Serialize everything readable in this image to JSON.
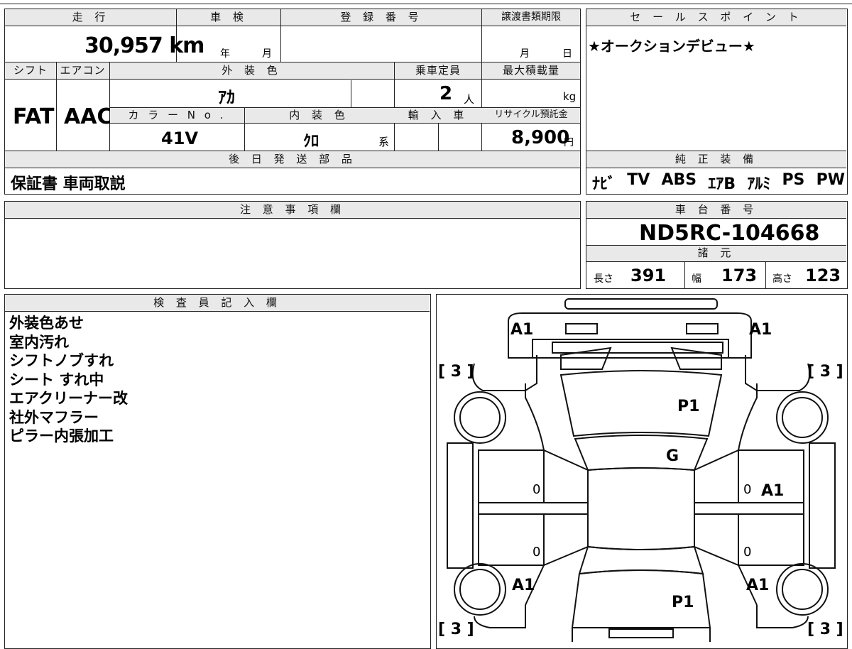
{
  "top_form": {
    "mileage": {
      "header": "走 行",
      "value": "30,957 km"
    },
    "shaken": {
      "header": "車 検",
      "year_unit": "年",
      "month_unit": "月"
    },
    "registration": {
      "header": "登 録 番 号",
      "value": ""
    },
    "transfer_deadline": {
      "header": "譲渡書類期限",
      "month_unit": "月",
      "day_unit": "日"
    },
    "shift": {
      "header": "シフト",
      "value": "FAT"
    },
    "aircon": {
      "header": "エアコン",
      "value": "AAC"
    },
    "exterior_color": {
      "header": "外 装 色",
      "value": "ｱｶ"
    },
    "capacity": {
      "header": "乗車定員",
      "value": "2",
      "unit": "人"
    },
    "max_load": {
      "header": "最大積載量",
      "unit": "kg"
    },
    "color_no": {
      "header": "カ ラ ー N o .",
      "value": "41V"
    },
    "interior_color": {
      "header": "内 装 色",
      "value": "ｸﾛ",
      "suffix": "系"
    },
    "import_car": {
      "header": "輸 入 車"
    },
    "recycle_fee": {
      "header": "リサイクル預託金",
      "value": "8,900",
      "unit": "円"
    },
    "later_parts": {
      "header": "後 日 発 送 部 品",
      "value": "保証書 車両取説"
    }
  },
  "sales_point": {
    "header": "セ ー ル ス ポ イ ン ト",
    "text": "★オークションデビュー★"
  },
  "genuine_equipment": {
    "header": "純 正 装 備",
    "items": [
      "ﾅﾋﾞ",
      "TV",
      "ABS",
      "ｴｱB",
      "ｱﾙﾐ",
      "PS",
      "PW"
    ]
  },
  "caution": {
    "header": "注 意 事 項 欄",
    "text": ""
  },
  "chassis": {
    "header": "車 台 番 号",
    "value": "ND5RC-104668"
  },
  "specs": {
    "header": "諸 元",
    "length_label": "長さ",
    "length": "391",
    "width_label": "幅",
    "width": "173",
    "height_label": "高さ",
    "height": "123"
  },
  "inspector": {
    "header": "検 査 員 記 入 欄",
    "notes": [
      "外装色あせ",
      "室内汚れ",
      "シフトノブすれ",
      "シート すれ中",
      "エアクリーナー改",
      "社外マフラー",
      "ピラー内張加工"
    ]
  },
  "diagram": {
    "marks": {
      "front_left": "A1",
      "front_right": "A1",
      "tire_fl": "[ 3 ]",
      "tire_fr": "[ 3 ]",
      "tire_rl": "[ 3 ]",
      "tire_rr": "[ 3 ]",
      "hood": "P1",
      "windshield": "G",
      "door_l_front": "0",
      "door_l_rear": "0",
      "door_r_front": "0",
      "door_r_rear": "0",
      "right_side": "A1",
      "rear_left": "A1",
      "rear_right": "A1",
      "trunk": "P1"
    }
  }
}
